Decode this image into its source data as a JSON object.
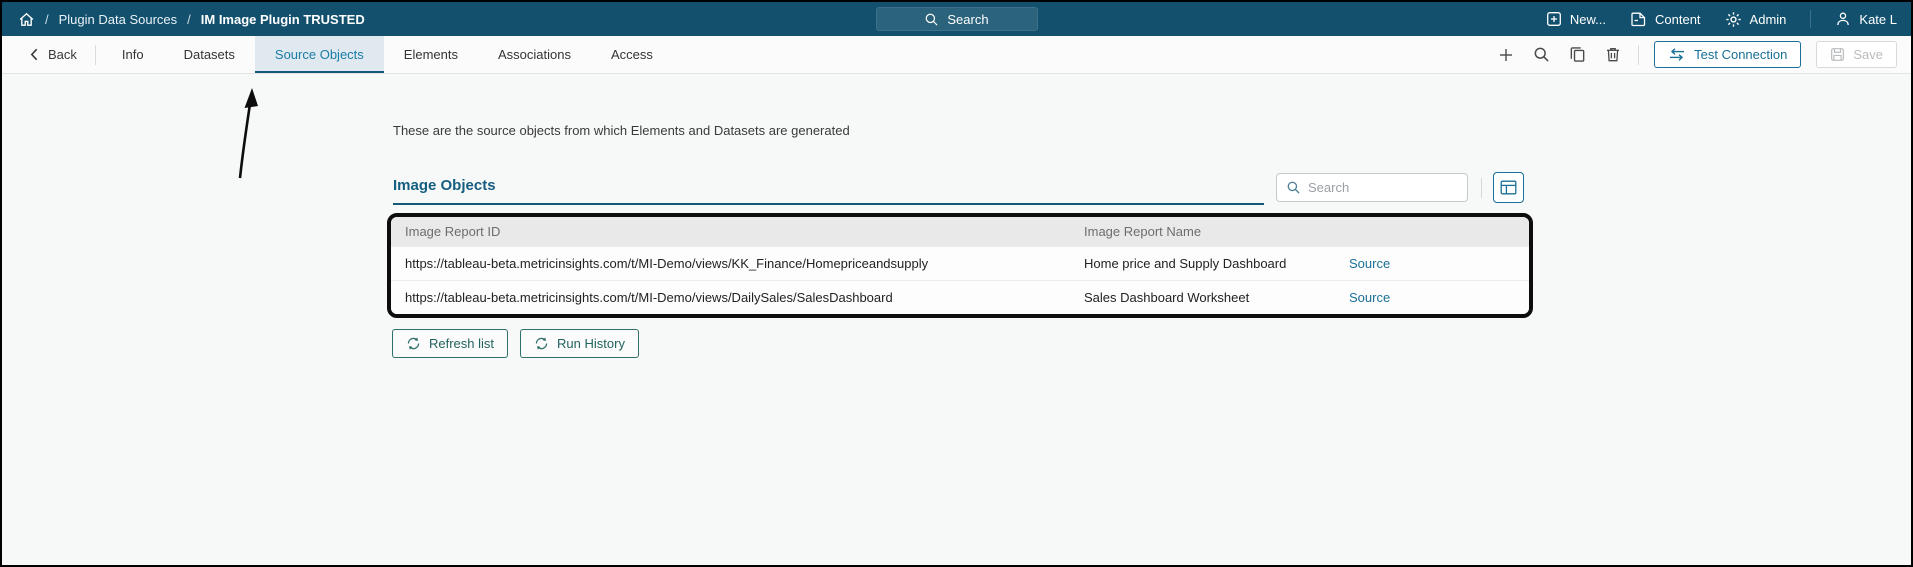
{
  "colors": {
    "header_bg": "#12506D",
    "accent_teal": "#1A7096",
    "active_tab_text": "#1B7CA6",
    "active_tab_bg": "#DFE9EF",
    "section_title_color": "#155E80",
    "refresh_button_teal": "#2F6F6A",
    "annotation_color": "#0D0D0D"
  },
  "header": {
    "breadcrumb": {
      "separator": "/",
      "items": [
        {
          "label": "Plugin Data Sources"
        },
        {
          "label": "IM Image Plugin TRUSTED"
        }
      ]
    },
    "search_label": "Search",
    "actions": {
      "new_label": "New...",
      "content_label": "Content",
      "admin_label": "Admin",
      "user_label": "Kate L"
    }
  },
  "toolbar": {
    "back_label": "Back",
    "tabs": [
      {
        "label": "Info",
        "active": false
      },
      {
        "label": "Datasets",
        "active": false
      },
      {
        "label": "Source Objects",
        "active": true
      },
      {
        "label": "Elements",
        "active": false
      },
      {
        "label": "Associations",
        "active": false
      },
      {
        "label": "Access",
        "active": false
      }
    ],
    "test_connection_label": "Test Connection",
    "save_label": "Save"
  },
  "main": {
    "description": "These are the source objects from which Elements and Datasets are generated",
    "section_title": "Image Objects",
    "search_placeholder": "Search",
    "table": {
      "columns": [
        "Image Report ID",
        "Image Report Name",
        ""
      ],
      "rows": [
        {
          "image_report_id": "https://tableau-beta.metricinsights.com/t/MI-Demo/views/KK_Finance/Homepriceandsupply",
          "image_report_name": "Home price and Supply Dashboard",
          "source_link": "Source"
        },
        {
          "image_report_id": "https://tableau-beta.metricinsights.com/t/MI-Demo/views/DailySales/SalesDashboard",
          "image_report_name": "Sales Dashboard Worksheet",
          "source_link": "Source"
        }
      ]
    },
    "refresh_button": "Refresh list",
    "run_history_button": "Run History"
  }
}
